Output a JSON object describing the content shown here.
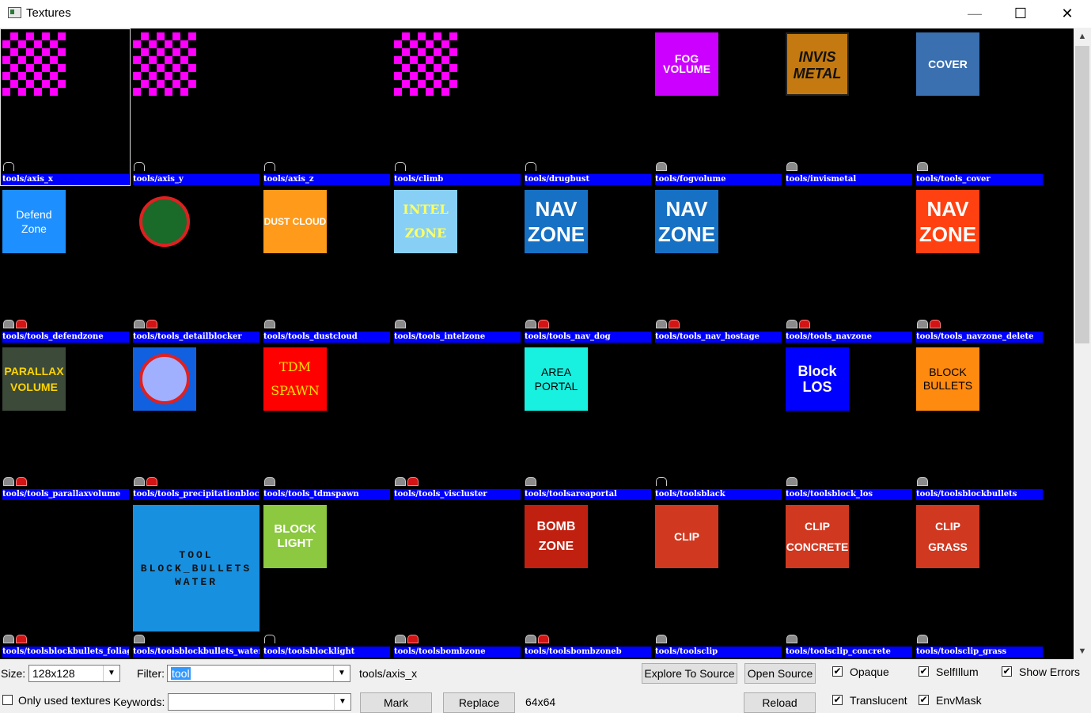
{
  "window": {
    "title": "Textures",
    "minimize": "—",
    "maximize": "☐",
    "close": "✕"
  },
  "grid": {
    "rows": [
      [
        {
          "name": "tools/axis_x",
          "thumb": "checker",
          "indicators": [
            "outline"
          ],
          "selected": true
        },
        {
          "name": "tools/axis_y",
          "thumb": "checker",
          "indicators": [
            "outline"
          ]
        },
        {
          "name": "tools/axis_z",
          "thumb": "none",
          "indicators": [
            "outline"
          ]
        },
        {
          "name": "tools/climb",
          "thumb": "checker",
          "indicators": [
            "outline"
          ]
        },
        {
          "name": "tools/drugbust",
          "thumb": "none",
          "indicators": [
            "outline"
          ]
        },
        {
          "name": "tools/fogvolume",
          "thumb": "fog",
          "text": [
            "FOG",
            "VOLUME"
          ],
          "indicators": [
            "grey"
          ]
        },
        {
          "name": "tools/invismetal",
          "thumb": "invis",
          "text": [
            "INVIS",
            "METAL"
          ],
          "indicators": [
            "grey"
          ]
        },
        {
          "name": "tools/tools_cover",
          "thumb": "cover",
          "text": [
            "COVER"
          ],
          "indicators": [
            "grey"
          ]
        }
      ],
      [
        {
          "name": "tools/tools_defendzone",
          "thumb": "defend",
          "text": [
            "Defend",
            "Zone"
          ],
          "indicators": [
            "grey",
            "red"
          ]
        },
        {
          "name": "tools/tools_detailblocker",
          "thumb": "detail",
          "indicators": [
            "grey",
            "red"
          ]
        },
        {
          "name": "tools/tools_dustcloud",
          "thumb": "dust",
          "text": [
            "DUST CLOUD"
          ],
          "indicators": [
            "grey"
          ]
        },
        {
          "name": "tools/tools_intelzone",
          "thumb": "intel",
          "text": [
            "INTEL",
            "ZONE"
          ],
          "indicators": [
            "grey"
          ]
        },
        {
          "name": "tools/tools_nav_dog",
          "thumb": "navblue",
          "text": [
            "NAV",
            "ZONE"
          ],
          "indicators": [
            "grey",
            "red"
          ]
        },
        {
          "name": "tools/tools_nav_hostage",
          "thumb": "navblue",
          "text": [
            "NAV",
            "ZONE"
          ],
          "indicators": [
            "grey",
            "red"
          ]
        },
        {
          "name": "tools/tools_navzone",
          "thumb": "none",
          "indicators": [
            "grey",
            "red"
          ]
        },
        {
          "name": "tools/tools_navzone_delete",
          "thumb": "navred",
          "text": [
            "NAV",
            "ZONE"
          ],
          "indicators": [
            "grey",
            "red"
          ]
        }
      ],
      [
        {
          "name": "tools/tools_parallaxvolume",
          "thumb": "parallax",
          "text": [
            "PARALLAX",
            "VOLUME"
          ],
          "indicators": [
            "grey",
            "red"
          ]
        },
        {
          "name": "tools/tools_precipitationblocker",
          "thumb": "precip",
          "indicators": [
            "grey",
            "red"
          ]
        },
        {
          "name": "tools/tools_tdmspawn",
          "thumb": "tdm",
          "text": [
            "TDM",
            "SPAWN"
          ],
          "indicators": [
            "grey"
          ]
        },
        {
          "name": "tools/tools_viscluster",
          "thumb": "none",
          "indicators": [
            "grey",
            "red"
          ]
        },
        {
          "name": "tools/toolsareaportal",
          "thumb": "area",
          "text": [
            "AREA",
            "PORTAL"
          ],
          "indicators": [
            "grey"
          ]
        },
        {
          "name": "tools/toolsblack",
          "thumb": "none",
          "indicators": [
            "outline"
          ]
        },
        {
          "name": "tools/toolsblock_los",
          "thumb": "blocklos",
          "text": [
            "Block",
            "LOS"
          ],
          "indicators": [
            "grey"
          ]
        },
        {
          "name": "tools/toolsblockbullets",
          "thumb": "blockbullets",
          "text": [
            "BLOCK",
            "BULLETS"
          ],
          "indicators": [
            "grey"
          ]
        }
      ],
      [
        {
          "name": "tools/toolsblockbullets_foliage",
          "thumb": "none",
          "indicators": [
            "grey",
            "red"
          ]
        },
        {
          "name": "tools/toolsblockbullets_water",
          "thumb": "water",
          "text": [
            "TOOL",
            "BLOCK_BULLETS",
            "WATER"
          ],
          "indicators": [
            "grey"
          ]
        },
        {
          "name": "tools/toolsblocklight",
          "thumb": "blocklight",
          "text": [
            "BLOCK",
            "LIGHT"
          ],
          "indicators": [
            "outline"
          ]
        },
        {
          "name": "tools/toolsbombzone",
          "thumb": "none",
          "indicators": [
            "grey",
            "red"
          ]
        },
        {
          "name": "tools/toolsbombzoneb",
          "thumb": "bomb",
          "text": [
            "BOMB",
            "ZONE"
          ],
          "indicators": [
            "grey",
            "red"
          ]
        },
        {
          "name": "tools/toolsclip",
          "thumb": "clip",
          "text": [
            "CLIP"
          ],
          "indicators": [
            "grey"
          ]
        },
        {
          "name": "tools/toolsclip_concrete",
          "thumb": "clipconcrete",
          "text": [
            "CLIP",
            "CONCRETE"
          ],
          "indicators": [
            "grey"
          ]
        },
        {
          "name": "tools/toolsclip_grass",
          "thumb": "clipgrass",
          "text": [
            "CLIP",
            "GRASS"
          ],
          "indicators": [
            "grey"
          ]
        }
      ]
    ]
  },
  "scrollbar": {
    "up": "▲",
    "down": "▼"
  },
  "controls": {
    "size_label": "Size:",
    "size_value": "128x128",
    "filter_label": "Filter:",
    "filter_value": "tool",
    "selected_name": "tools/axis_x",
    "selected_size": "64x64",
    "only_used_label": "Only used textures",
    "keywords_label": "Keywords:",
    "keywords_value": "",
    "mark": "Mark",
    "replace": "Replace",
    "explore": "Explore To Source",
    "open_source": "Open Source",
    "reload": "Reload",
    "opaque": "Opaque",
    "selfillum": "SelfIllum",
    "show_errors": "Show Errors",
    "translucent": "Translucent",
    "envmask": "EnvMask",
    "dropdown_arrow": "▼",
    "check_mark": "✔"
  },
  "checkboxes": {
    "opaque": true,
    "selfillum": true,
    "show_errors": true,
    "translucent": true,
    "envmask": true,
    "only_used": false
  }
}
